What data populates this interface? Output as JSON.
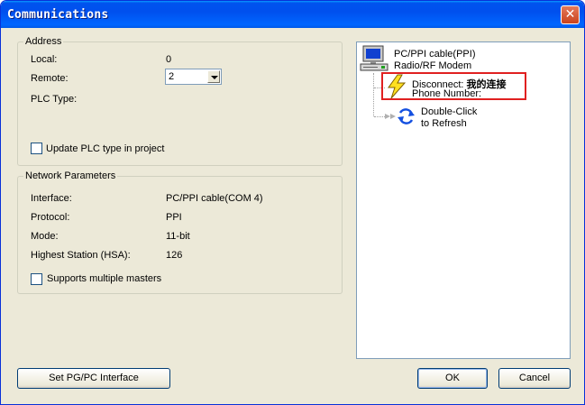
{
  "window": {
    "title": "Communications",
    "close_glyph": "✕"
  },
  "address": {
    "title": "Address",
    "local_label": "Local:",
    "local_value": "0",
    "remote_label": "Remote:",
    "remote_value": "2",
    "plc_type_label": "PLC Type:",
    "update_plc_label": "Update PLC type in project",
    "update_plc_checked": false
  },
  "network": {
    "title": "Network Parameters",
    "rows": [
      {
        "label": "Interface:",
        "value": "PC/PPI cable(COM 4)"
      },
      {
        "label": "Protocol:",
        "value": "PPI"
      },
      {
        "label": "Mode:",
        "value": "11-bit"
      },
      {
        "label": "Highest Station (HSA):",
        "value": "126"
      }
    ],
    "multi_masters_label": "Supports multiple masters",
    "multi_masters_checked": false
  },
  "tree": {
    "root_line1": "PC/PPI cable(PPI)",
    "root_line2": "Radio/RF Modem",
    "conn_prefix": "Disconnect:",
    "conn_name": "我的连接",
    "phone_label": "Phone Number:",
    "refresh_line1": "Double-Click",
    "refresh_line2": "to Refresh",
    "icons": {
      "root": "computer-modem-icon",
      "connection": "lightning-bolt-icon",
      "refresh": "refresh-arrows-icon"
    },
    "highlight_color": "#e02020"
  },
  "buttons": {
    "set_pgpc": "Set PG/PC Interface",
    "ok": "OK",
    "cancel": "Cancel"
  }
}
